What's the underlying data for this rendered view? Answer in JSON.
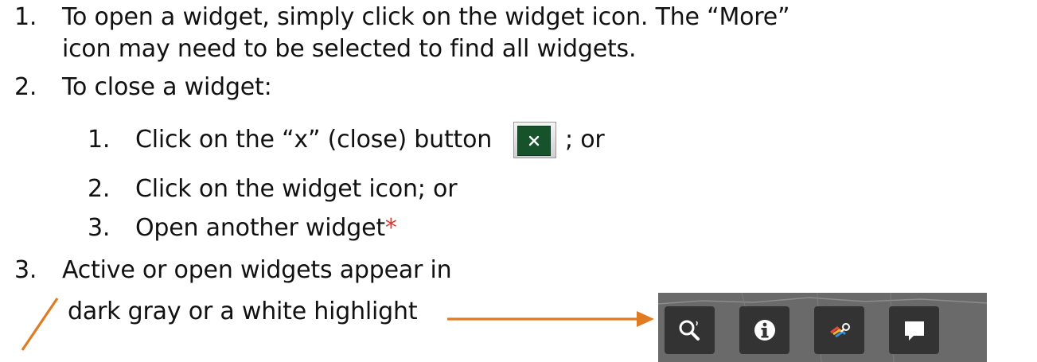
{
  "items": [
    {
      "num": "1.",
      "text": "To open a widget, simply click on the widget icon.  The “More”"
    },
    {
      "text": "icon may need to be selected to find all widgets."
    },
    {
      "num": "2.",
      "text": "To close a widget:"
    },
    {
      "num": "1.",
      "text": "Click on the “x” (close) button",
      "suffix": "; or"
    },
    {
      "num": "2.",
      "text": "Click on the widget icon; or"
    },
    {
      "num": "3.",
      "text": "Open another widget",
      "mark": "*"
    },
    {
      "num": "3.",
      "text": "Active or open widgets appear in"
    },
    {
      "text": "dark gray or a white highlight"
    }
  ],
  "close_button": {
    "glyph": "×",
    "icon": "close-icon",
    "color": "#16532a"
  },
  "widget_icons": [
    {
      "name": "search-icon"
    },
    {
      "name": "info-icon"
    },
    {
      "name": "layer-icon"
    },
    {
      "name": "chat-icon"
    }
  ],
  "colors": {
    "arrow": "#e07b22",
    "asterisk": "#e8352c",
    "bar": "#6a6a6a",
    "icon_bg": "#333333"
  }
}
